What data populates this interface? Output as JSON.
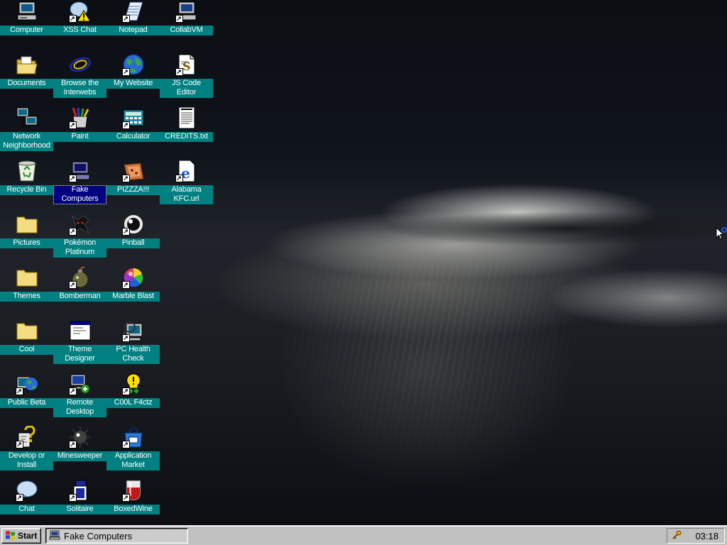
{
  "desktop": {
    "wallpaper": "stormy sky with rays of light",
    "icons": [
      {
        "label": "Computer",
        "icon": "computer-icon",
        "shortcut": false
      },
      {
        "label": "XSS Chat",
        "icon": "chat-warning-icon",
        "shortcut": true
      },
      {
        "label": "Notepad",
        "icon": "notepad-icon",
        "shortcut": true
      },
      {
        "label": "CollabVM",
        "icon": "computer-icon",
        "shortcut": true
      },
      {
        "label": "Documents",
        "icon": "folder-open-icon",
        "shortcut": false
      },
      {
        "label": "Browse the\nInterwebs",
        "icon": "browser-icon",
        "shortcut": false
      },
      {
        "label": "My Website",
        "icon": "globe-icon",
        "shortcut": true
      },
      {
        "label": "JS Code\nEditor",
        "icon": "code-editor-icon",
        "shortcut": true
      },
      {
        "label": "Network\nNeighborhood",
        "icon": "network-icon",
        "shortcut": false
      },
      {
        "label": "Paint",
        "icon": "paint-icon",
        "shortcut": true
      },
      {
        "label": "Calculator",
        "icon": "calculator-icon",
        "shortcut": true
      },
      {
        "label": "CREDITS.txt",
        "icon": "text-file-icon",
        "shortcut": false
      },
      {
        "label": "Recycle Bin",
        "icon": "recycle-bin-icon",
        "shortcut": false
      },
      {
        "label": "Fake\nComputers",
        "icon": "computer-icon",
        "shortcut": true,
        "selected": true
      },
      {
        "label": "PIZZZA!!!",
        "icon": "pizza-icon",
        "shortcut": true
      },
      {
        "label": "Alabama\nKFC.url",
        "icon": "internet-shortcut-icon",
        "shortcut": true
      },
      {
        "label": "Pictures",
        "icon": "folder-icon",
        "shortcut": false
      },
      {
        "label": "Pokémon\nPlatinum",
        "icon": "pokemon-icon",
        "shortcut": true
      },
      {
        "label": "Pinball",
        "icon": "pinball-icon",
        "shortcut": true
      },
      {
        "label": "Themes",
        "icon": "folder-icon",
        "shortcut": false
      },
      {
        "label": "Bomberman",
        "icon": "bomb-icon",
        "shortcut": true
      },
      {
        "label": "Marble Blast",
        "icon": "marble-icon",
        "shortcut": true
      },
      {
        "label": "Cool",
        "icon": "folder-icon",
        "shortcut": false
      },
      {
        "label": "Theme\nDesigner",
        "icon": "window-icon",
        "shortcut": false
      },
      {
        "label": "PC Health\nCheck",
        "icon": "health-check-icon",
        "shortcut": true
      },
      {
        "label": "Public Beta",
        "icon": "public-beta-icon",
        "shortcut": true
      },
      {
        "label": "Remote\nDesktop",
        "icon": "remote-desktop-icon",
        "shortcut": true
      },
      {
        "label": "C00L F4ctz",
        "icon": "tip-icon",
        "shortcut": true
      },
      {
        "label": "Develop or\nInstall",
        "icon": "help-icon",
        "shortcut": true
      },
      {
        "label": "Minesweeper",
        "icon": "mine-icon",
        "shortcut": true
      },
      {
        "label": "Application\nMarket",
        "icon": "app-market-icon",
        "shortcut": true
      },
      {
        "label": "Chat",
        "icon": "speech-bubble-icon",
        "shortcut": true
      },
      {
        "label": "Solitaire",
        "icon": "solitaire-icon",
        "shortcut": true
      },
      {
        "label": "BoxedWine",
        "icon": "wine-glass-icon",
        "shortcut": true
      }
    ]
  },
  "taskbar": {
    "start_label": "Start",
    "task_label": "Fake Computers",
    "clock": "03:18"
  },
  "colors": {
    "label_bg": "#008080",
    "selected_bg": "#000080",
    "taskbar": "#c0c0c0"
  }
}
